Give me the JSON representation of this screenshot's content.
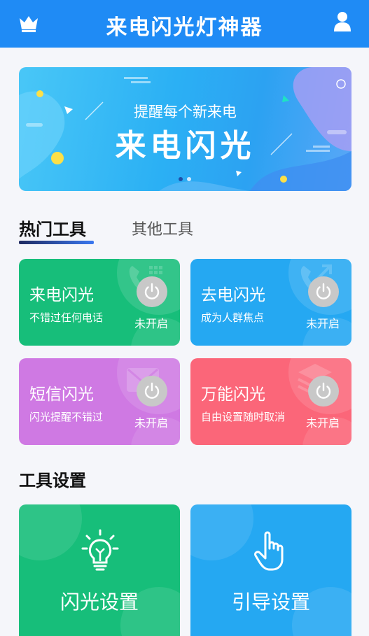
{
  "header": {
    "title": "来电闪光灯神器",
    "left_icon": "crown-icon",
    "right_icon": "user-icon",
    "bg_color": "#1f8bf5"
  },
  "banner": {
    "subtitle": "提醒每个新来电",
    "headline": "来电闪光",
    "slide_count": 2,
    "active_slide": 1
  },
  "tabs": [
    {
      "label": "热门工具",
      "active": true
    },
    {
      "label": "其他工具",
      "active": false
    }
  ],
  "tools": [
    {
      "title": "来电闪光",
      "desc": "不错过任何电话",
      "status": "未开启",
      "color": "#17be7a",
      "icon": "phone-icon"
    },
    {
      "title": "去电闪光",
      "desc": "成为人群焦点",
      "status": "未开启",
      "color": "#25a8f2",
      "icon": "phone-outgoing-icon"
    },
    {
      "title": "短信闪光",
      "desc": "闪光提醒不错过",
      "status": "未开启",
      "color": "#cf79e3",
      "icon": "envelope-icon"
    },
    {
      "title": "万能闪光",
      "desc": "自由设置随时取消",
      "status": "未开启",
      "color": "#fb6679",
      "icon": "layers-icon"
    }
  ],
  "settings": {
    "title": "工具设置",
    "items": [
      {
        "label": "闪光设置",
        "color": "#17be7a",
        "icon": "lightbulb-icon"
      },
      {
        "label": "引导设置",
        "color": "#25a8f2",
        "icon": "hand-pointer-icon"
      }
    ]
  }
}
